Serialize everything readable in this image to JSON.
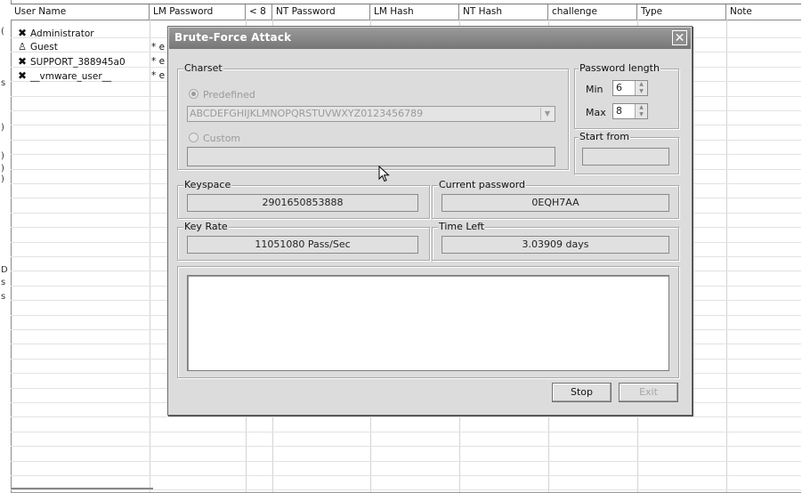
{
  "grid": {
    "columns": [
      "User Name",
      "LM Password",
      "< 8",
      "NT Password",
      "LM Hash",
      "NT Hash",
      "challenge",
      "Type",
      "Note"
    ],
    "users": [
      {
        "name": "Administrator",
        "icon": "x-icon",
        "lm": ""
      },
      {
        "name": "Guest",
        "icon": "user-icon",
        "lm": "* e"
      },
      {
        "name": "SUPPORT_388945a0",
        "icon": "x-icon",
        "lm": "* e"
      },
      {
        "name": "__vmware_user__",
        "icon": "x-icon",
        "lm": "* e"
      }
    ],
    "left_strip_chars": [
      "(",
      "s",
      ")",
      ")",
      ")",
      ")",
      "D",
      "s",
      "s"
    ]
  },
  "dialog": {
    "title": "Brute-Force Attack",
    "charset": {
      "label": "Charset",
      "predefined_label": "Predefined",
      "predefined_value": "ABCDEFGHIJKLMNOPQRSTUVWXYZ0123456789",
      "custom_label": "Custom",
      "custom_value": ""
    },
    "password_length": {
      "label": "Password length",
      "min_label": "Min",
      "min_value": "6",
      "max_label": "Max",
      "max_value": "8"
    },
    "start_from": {
      "label": "Start from",
      "value": ""
    },
    "keyspace": {
      "label": "Keyspace",
      "value": "2901650853888"
    },
    "current_password": {
      "label": "Current password",
      "value": "0EQH7AA"
    },
    "key_rate": {
      "label": "Key Rate",
      "value": "11051080 Pass/Sec"
    },
    "time_left": {
      "label": "Time Left",
      "value": "3.03909 days"
    },
    "buttons": {
      "stop": "Stop",
      "exit": "Exit"
    },
    "close_glyph": "✕"
  }
}
